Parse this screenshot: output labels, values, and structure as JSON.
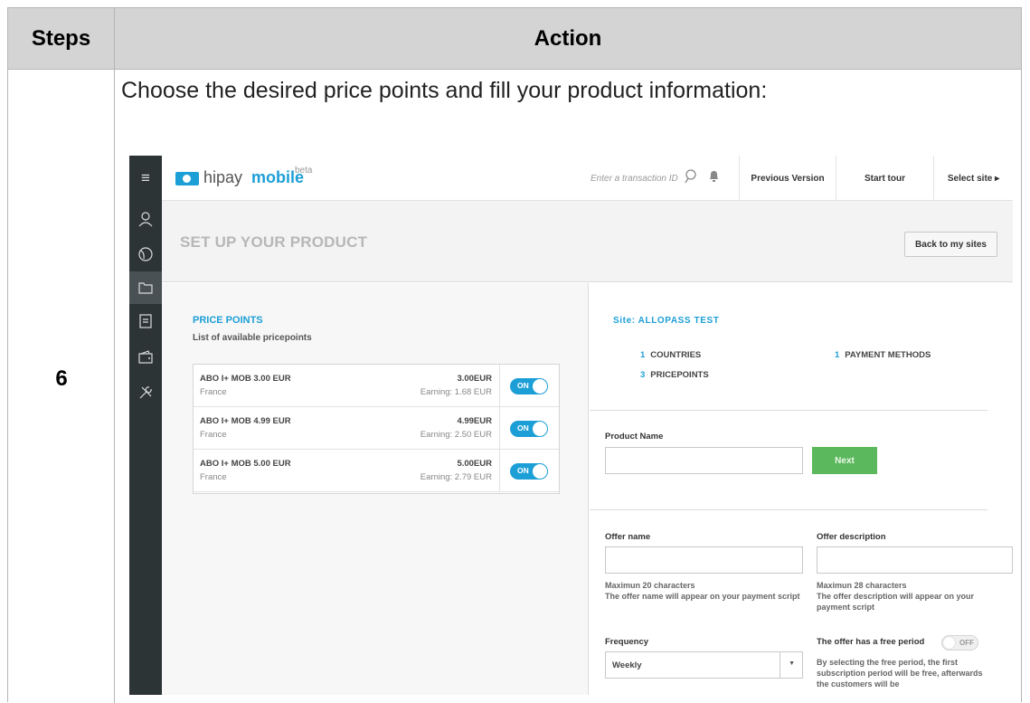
{
  "table": {
    "header_steps": "Steps",
    "header_action": "Action",
    "step_number": "6",
    "instruction": "Choose the desired price points and fill your product information:"
  },
  "app": {
    "logo_text": "hipay",
    "logo_bold": "mobile",
    "logo_beta": "beta",
    "search_placeholder": "Enter a transaction ID",
    "nav": {
      "previous_version": "Previous Version",
      "start_tour": "Start tour",
      "select_site": "Select site ▸"
    },
    "sidebar_icons": [
      "user-icon",
      "globe-icon",
      "folder-icon",
      "document-icon",
      "wallet-icon",
      "tools-icon"
    ],
    "page_title": "SET UP YOUR PRODUCT",
    "back_button": "Back to my sites",
    "accent_color": "#1c9fd6",
    "success_color": "#5cb85c"
  },
  "price_points": {
    "title": "PRICE POINTS",
    "subtitle": "List of available pricepoints",
    "items": [
      {
        "name": "ABO I+ MOB 3.00 EUR",
        "country": "France",
        "price": "3.00EUR",
        "earning": "Earning: 1.68 EUR",
        "toggle": "ON"
      },
      {
        "name": "ABO I+ MOB 4.99 EUR",
        "country": "France",
        "price": "4.99EUR",
        "earning": "Earning: 2.50 EUR",
        "toggle": "ON"
      },
      {
        "name": "ABO I+ MOB 5.00 EUR",
        "country": "France",
        "price": "5.00EUR",
        "earning": "Earning: 2.79 EUR",
        "toggle": "ON"
      }
    ]
  },
  "site": {
    "title": "Site: ALLOPASS TEST",
    "countries_count": "1",
    "countries_label": "COUNTRIES",
    "payment_count": "1",
    "payment_label": "PAYMENT METHODS",
    "pricepoints_count": "3",
    "pricepoints_label": "PRICEPOINTS"
  },
  "form": {
    "product_name_label": "Product Name",
    "product_name_value": "",
    "next_button": "Next",
    "offer_name_label": "Offer name",
    "offer_name_help_1": "Maximun 20 characters",
    "offer_name_help_2": "The offer name will appear on your payment script",
    "offer_desc_label": "Offer description",
    "offer_desc_help_1": "Maximun 28 characters",
    "offer_desc_help_2": "The offer description will appear on your payment script",
    "frequency_label": "Frequency",
    "frequency_value": "Weekly",
    "free_period_label": "The offer has a free period",
    "free_period_toggle": "OFF",
    "free_period_help": "By selecting the free period, the first subscription period will be free, afterwards the customers will be"
  }
}
